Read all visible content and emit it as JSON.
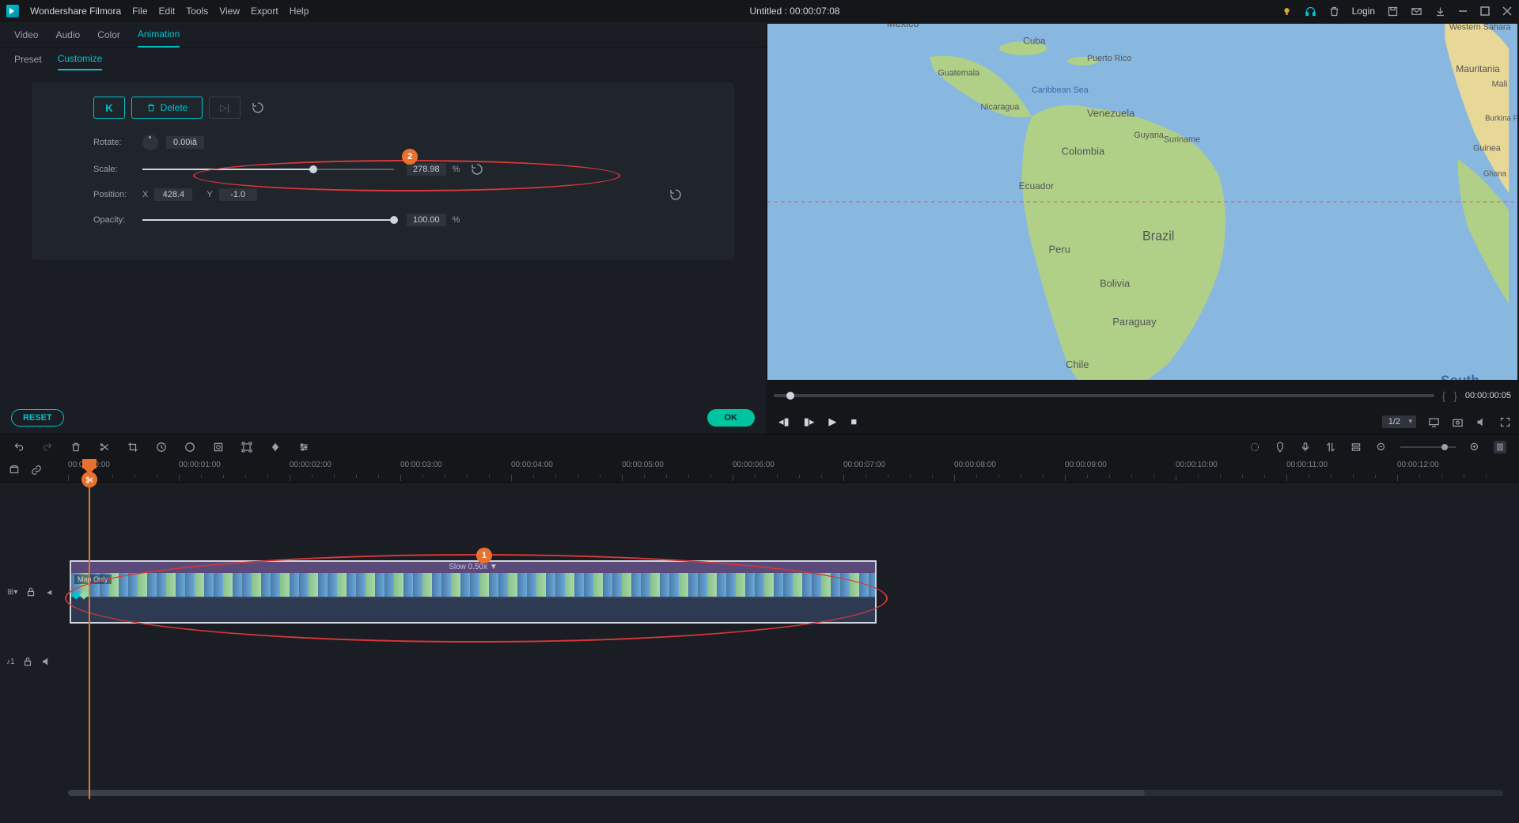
{
  "titlebar": {
    "app_name": "Wondershare Filmora",
    "menus": [
      "File",
      "Edit",
      "Tools",
      "View",
      "Export",
      "Help"
    ],
    "doc_title": "Untitled : 00:00:07:08",
    "login": "Login"
  },
  "top_tabs": [
    "Video",
    "Audio",
    "Color",
    "Animation"
  ],
  "top_tab_active": 3,
  "sub_tabs": [
    "Preset",
    "Customize"
  ],
  "sub_tab_active": 1,
  "keyframe": {
    "k": "K",
    "delete": "Delete"
  },
  "props": {
    "rotate_label": "Rotate:",
    "rotate_value": "0.00iâ",
    "scale_label": "Scale:",
    "scale_value": "278.98",
    "scale_pct": "%",
    "position_label": "Position:",
    "pos_x_label": "X",
    "pos_x": "428.4",
    "pos_y_label": "Y",
    "pos_y": "-1.0",
    "opacity_label": "Opacity:",
    "opacity_value": "100.00",
    "opacity_pct": "%"
  },
  "annotations": {
    "badge1": "1",
    "badge2": "2"
  },
  "buttons": {
    "reset": "RESET",
    "ok": "OK"
  },
  "preview": {
    "timecode_right": "00:00:00:05",
    "ratio": "1/2"
  },
  "ruler_ticks": [
    "00:00:00:00",
    "00:00:01:00",
    "00:00:02:00",
    "00:00:03:00",
    "00:00:04:00",
    "00:00:05:00",
    "00:00:06:00",
    "00:00:07:00",
    "00:00:08:00",
    "00:00:09:00",
    "00:00:10:00",
    "00:00:11:00",
    "00:00:12:00"
  ],
  "clip": {
    "speed": "Slow 0.50x ▼",
    "label": "Map Only"
  },
  "track_labels": {
    "video": "⊞",
    "audio": "♪1"
  }
}
